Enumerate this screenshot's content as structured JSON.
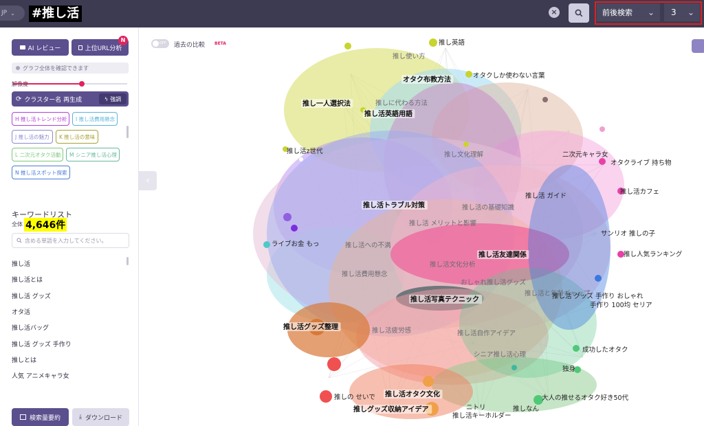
{
  "topbar": {
    "lang": "JP",
    "query": "#推し活",
    "mode_select": "前後検索",
    "depth_select": "3"
  },
  "sidebar": {
    "ai_review": "AI レビュー",
    "url_analysis": "上位URL分析",
    "url_badge": "N",
    "graph_note": "グラフ全体を確認できます",
    "resolution_label": "解像度",
    "resolution_value": 0.6,
    "cluster_regen": "クラスター名 再生成",
    "emphasis": "強調",
    "clusters": [
      {
        "label": "H 推し活トレンド分析",
        "color": "#b03fd6"
      },
      {
        "label": "I 推し活費用懸念",
        "color": "#5bb4d8"
      },
      {
        "label": "J 推し活の魅力",
        "color": "#8a8ad0"
      },
      {
        "label": "K 推し活の意味",
        "color": "#a8a032"
      },
      {
        "label": "L 二次元オタク活動",
        "color": "#7cc87c"
      },
      {
        "label": "M シニア推し活心理",
        "color": "#66b8a0"
      },
      {
        "label": "N 推し活スポット探索",
        "color": "#4a7ad8"
      }
    ],
    "keyword_list_title": "キーワードリスト",
    "keyword_all_label": "全体",
    "keyword_count": "4,646件",
    "keyword_search_placeholder": "含める単語を入力してください。",
    "keywords": [
      "推し活",
      "推し活とは",
      "推し活 グッズ",
      "オタ活",
      "推し活バッグ",
      "推し活 グッズ 手作り",
      "推しとは",
      "人気 アニメキャラ女"
    ],
    "search_volume_btn": "検索量要約",
    "download_btn": "ダウンロード"
  },
  "graph": {
    "compare_toggle": "OFF",
    "compare_label": "過去の比較",
    "beta": "BETA",
    "labels_bold": [
      "オタク布教方法",
      "推し一人選択法",
      "推し活英語用語",
      "推し活トラブル対策",
      "推し活友達関係",
      "推し活写真テクニック",
      "推し活グッズ整理",
      "推し活オタク文化",
      "推しグッズ収納アイデア"
    ],
    "labels_cluster": [
      "推し文化理解",
      "推し活の基礎知識",
      "推し活 メリットと影響",
      "推し活文化分析",
      "おしゃれ推し活グッズ",
      "推し活と年齢ギャップ",
      "推し活疲労感",
      "推し活自作アイデア",
      "シニア推し活心理",
      "推し活費用懸念",
      "推し活への不満",
      "推し使い方",
      "推しに代わる方法"
    ],
    "labels_node": [
      "推し英語",
      "オタクしか使わない言葉",
      "推し活z世代",
      "オタクライブ 持ち物",
      "推し活カフェ",
      "サンリオ 推しの子",
      "推し人気ランキング",
      "ライブお金 もっ",
      "成功したオタク",
      "推しの せいで",
      "大人の推せるオタク好き50代",
      "推しなん",
      "推し活キーホルダー",
      "ニトリ",
      "手作り 100均 セリア",
      "推し活 グッズ 手作り おしゃれ",
      "独身",
      "推し活 ガイド",
      "二次元キャラ女"
    ]
  }
}
